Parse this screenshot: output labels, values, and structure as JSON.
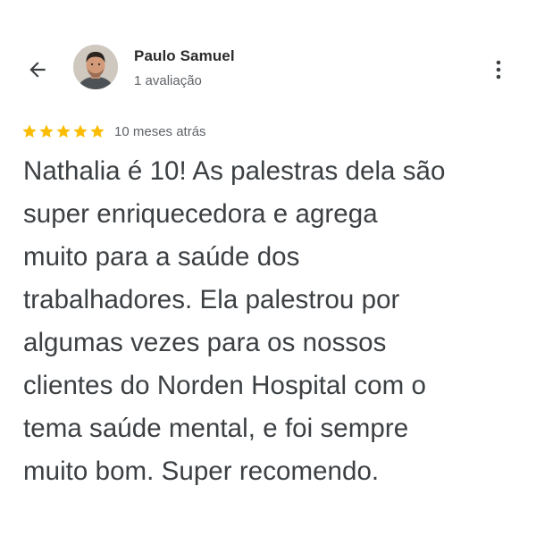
{
  "header": {
    "back_icon": "arrow-left-icon",
    "more_icon": "more-vertical-icon"
  },
  "author": {
    "name": "Paulo Samuel",
    "review_count": "1 avaliação",
    "avatar": "avatar-photo"
  },
  "rating": {
    "stars": 5,
    "max_stars": 5,
    "star_color": "#fbbc04",
    "date": "10 meses atrás"
  },
  "review": {
    "lines": [
      "Nathalia é 10! As palestras dela são",
      "super enriquecedora e agrega",
      "muito para a saúde dos",
      "trabalhadores. Ela palestrou por",
      "algumas vezes para os nossos",
      "clientes do Norden Hospital com o",
      "tema saúde mental, e foi sempre",
      "muito bom. Super recomendo."
    ]
  }
}
